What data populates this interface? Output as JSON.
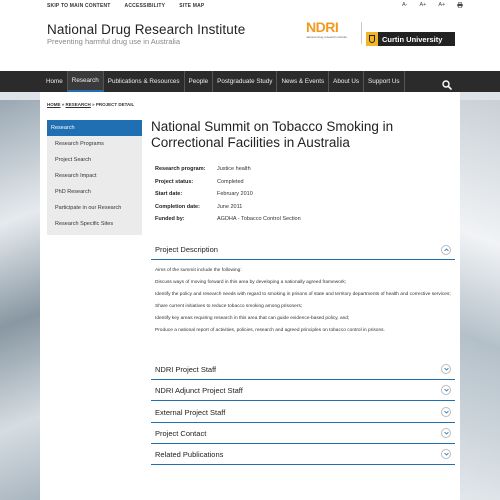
{
  "topbar": {
    "links": [
      "SKIP TO MAIN CONTENT",
      "ACCESSIBILITY",
      "SITE MAP"
    ],
    "font_tools": [
      "A-",
      "A+",
      "A+"
    ]
  },
  "header": {
    "title": "National Drug Research Institute",
    "subtitle": "Preventing harmful drug use in Australia",
    "ndri_logo": "NDRI",
    "ndri_tagline": "national drug research institute",
    "curtin_logo": "Curtin University"
  },
  "nav": {
    "items": [
      "Home",
      "Research",
      "Publications & Resources",
      "People",
      "Postgraduate Study",
      "News & Events",
      "About Us",
      "Support Us"
    ],
    "active_index": 1
  },
  "breadcrumb": {
    "home": "HOME",
    "research": "RESEARCH",
    "current": "PROJECT DETAIL",
    "separator": "»"
  },
  "sidebar": {
    "items": [
      "Research",
      "Research Programs",
      "Project Search",
      "Research Impact",
      "PhD Research",
      "Participate in our Research",
      "Research Specific Sites"
    ]
  },
  "project": {
    "title": "National Summit on Tobacco Smoking in Correctional Facilities in Australia",
    "details": [
      {
        "label": "Research program:",
        "value": "Justice health"
      },
      {
        "label": "Project status:",
        "value": "Completed"
      },
      {
        "label": "Start date:",
        "value": "February 2010"
      },
      {
        "label": "Completion date:",
        "value": "June 2011"
      },
      {
        "label": "Funded by:",
        "value": "AGDHA - Tobacco Control Section"
      }
    ]
  },
  "description": {
    "heading": "Project Description",
    "paragraphs": [
      "Aims of the summit include the following:",
      "Discuss ways of moving forward in this area by developing a nationally agreed framework;",
      "Identify the policy and research needs with regard to smoking in prisons of state and territory departments of health and corrective services;",
      "Share current initiatives to reduce tobacco smoking among prisoners;",
      "Identify key areas requiring research in this area that can guide evidence-based policy, and;",
      "Produce a national report of activities, policies, research and agreed principles on tobacco control in prisons."
    ]
  },
  "accordions": [
    "NDRI Project Staff",
    "NDRI Adjunct Project Staff",
    "External Project Staff",
    "Project Contact",
    "Related Publications"
  ],
  "colors": {
    "accent": "#1f6fb2",
    "nav_bg": "#2b2b2b",
    "ndri_orange": "#f29a1f",
    "curtin_gold": "#f2b527"
  }
}
